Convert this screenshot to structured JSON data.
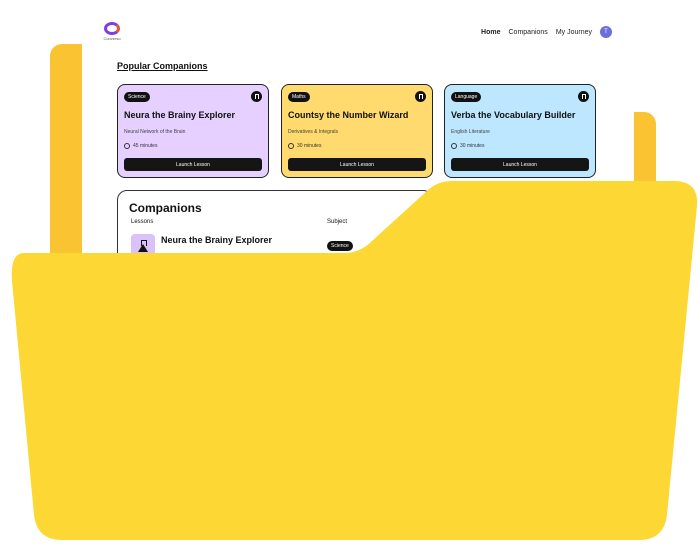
{
  "nav": {
    "logo_text": "Converso",
    "links": [
      "Home",
      "Companions",
      "My Journey"
    ],
    "avatar_initial": "T"
  },
  "popular": {
    "title": "Popular Companions",
    "cards": [
      {
        "subject": "Science",
        "title": "Neura the Brainy Explorer",
        "topic": "Neural Network of the Brain",
        "duration": "45 minutes",
        "button": "Launch Lesson",
        "color": "#E5D0FF"
      },
      {
        "subject": "Maths",
        "title": "Countsy the Number Wizard",
        "topic": "Derivatives & Integrals",
        "duration": "30 minutes",
        "button": "Launch Lesson",
        "color": "#FFDA6E"
      },
      {
        "subject": "Language",
        "title": "Verba the Vocabulary Builder",
        "topic": "English Literature",
        "duration": "30 minutes",
        "button": "Launch Lesson",
        "color": "#BDE7FF"
      }
    ]
  },
  "companions": {
    "title": "Companions",
    "col_lessons": "Lessons",
    "col_subject": "Subject",
    "rows": [
      {
        "name": "Neura the Brainy Explorer",
        "subject": "Science",
        "icon": "flask-icon"
      }
    ]
  },
  "colors": {
    "folder_front": "#FDD835",
    "folder_back": "#F9C332",
    "accent": "#7B3FE4"
  }
}
